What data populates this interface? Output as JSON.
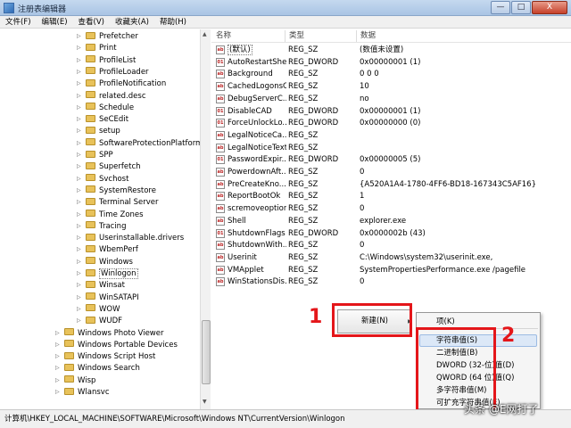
{
  "window": {
    "title": "注册表编辑器",
    "controls": [
      "—",
      "□",
      "X"
    ]
  },
  "menu": [
    "文件(F)",
    "编辑(E)",
    "查看(V)",
    "收藏夹(A)",
    "帮助(H)"
  ],
  "tree_items": [
    {
      "label": "Prefetcher",
      "level": 1
    },
    {
      "label": "Print",
      "level": 1
    },
    {
      "label": "ProfileList",
      "level": 1
    },
    {
      "label": "ProfileLoader",
      "level": 1
    },
    {
      "label": "ProfileNotification",
      "level": 1
    },
    {
      "label": "related.desc",
      "level": 1
    },
    {
      "label": "Schedule",
      "level": 1
    },
    {
      "label": "SeCEdit",
      "level": 1
    },
    {
      "label": "setup",
      "level": 1
    },
    {
      "label": "SoftwareProtectionPlatform",
      "level": 1
    },
    {
      "label": "SPP",
      "level": 1
    },
    {
      "label": "Superfetch",
      "level": 1
    },
    {
      "label": "Svchost",
      "level": 1
    },
    {
      "label": "SystemRestore",
      "level": 1
    },
    {
      "label": "Terminal Server",
      "level": 1
    },
    {
      "label": "Time Zones",
      "level": 1
    },
    {
      "label": "Tracing",
      "level": 1
    },
    {
      "label": "Userinstallable.drivers",
      "level": 1
    },
    {
      "label": "WbemPerf",
      "level": 1
    },
    {
      "label": "Windows",
      "level": 1
    },
    {
      "label": "Winlogon",
      "level": 1,
      "selected": true
    },
    {
      "label": "Winsat",
      "level": 1
    },
    {
      "label": "WinSATAPI",
      "level": 1
    },
    {
      "label": "WOW",
      "level": 1
    },
    {
      "label": "WUDF",
      "level": 1
    },
    {
      "label": "Windows Photo Viewer",
      "level": 0
    },
    {
      "label": "Windows Portable Devices",
      "level": 0
    },
    {
      "label": "Windows Script Host",
      "level": 0
    },
    {
      "label": "Windows Search",
      "level": 0
    },
    {
      "label": "Wisp",
      "level": 0
    },
    {
      "label": "Wlansvc",
      "level": 0
    }
  ],
  "columns": {
    "name": "名称",
    "type": "类型",
    "data": "数据"
  },
  "values": [
    {
      "name": "(默认)",
      "type": "REG_SZ",
      "data": "(数值未设置)"
    },
    {
      "name": "AutoRestartShell",
      "type": "REG_DWORD",
      "data": "0x00000001 (1)"
    },
    {
      "name": "Background",
      "type": "REG_SZ",
      "data": "0 0 0"
    },
    {
      "name": "CachedLogonsC...",
      "type": "REG_SZ",
      "data": "10"
    },
    {
      "name": "DebugServerC...",
      "type": "REG_SZ",
      "data": "no"
    },
    {
      "name": "DisableCAD",
      "type": "REG_DWORD",
      "data": "0x00000001 (1)"
    },
    {
      "name": "ForceUnlockLo...",
      "type": "REG_DWORD",
      "data": "0x00000000 (0)"
    },
    {
      "name": "LegalNoticeCa...",
      "type": "REG_SZ",
      "data": ""
    },
    {
      "name": "LegalNoticeText",
      "type": "REG_SZ",
      "data": ""
    },
    {
      "name": "PasswordExpir...",
      "type": "REG_DWORD",
      "data": "0x00000005 (5)"
    },
    {
      "name": "PowerdownAft...",
      "type": "REG_SZ",
      "data": "0"
    },
    {
      "name": "PreCreateKno...",
      "type": "REG_SZ",
      "data": "{A520A1A4-1780-4FF6-BD18-167343C5AF16}"
    },
    {
      "name": "ReportBootOk",
      "type": "REG_SZ",
      "data": "1"
    },
    {
      "name": "scremoveoption",
      "type": "REG_SZ",
      "data": "0"
    },
    {
      "name": "Shell",
      "type": "REG_SZ",
      "data": "explorer.exe"
    },
    {
      "name": "ShutdownFlags",
      "type": "REG_DWORD",
      "data": "0x0000002b (43)"
    },
    {
      "name": "ShutdownWith...",
      "type": "REG_SZ",
      "data": "0"
    },
    {
      "name": "Userinit",
      "type": "REG_SZ",
      "data": "C:\\Windows\\system32\\userinit.exe,"
    },
    {
      "name": "VMApplet",
      "type": "REG_SZ",
      "data": "SystemPropertiesPerformance.exe /pagefile"
    },
    {
      "name": "WinStationsDis...",
      "type": "REG_SZ",
      "data": "0"
    }
  ],
  "context_menu": {
    "new_label": "新建(N)"
  },
  "submenu": [
    "项(K)",
    "字符串值(S)",
    "二进制值(B)",
    "DWORD (32-位)值(D)",
    "QWORD (64 位)值(Q)",
    "多字符串值(M)",
    "可扩充字符串值(E)"
  ],
  "statusbar": "计算机\\HKEY_LOCAL_MACHINE\\SOFTWARE\\Microsoft\\Windows NT\\CurrentVersion\\Winlogon",
  "annotations": {
    "step1": "1",
    "step2": "2",
    "color": "#e4161a"
  },
  "watermark": "头条 @E网打了"
}
